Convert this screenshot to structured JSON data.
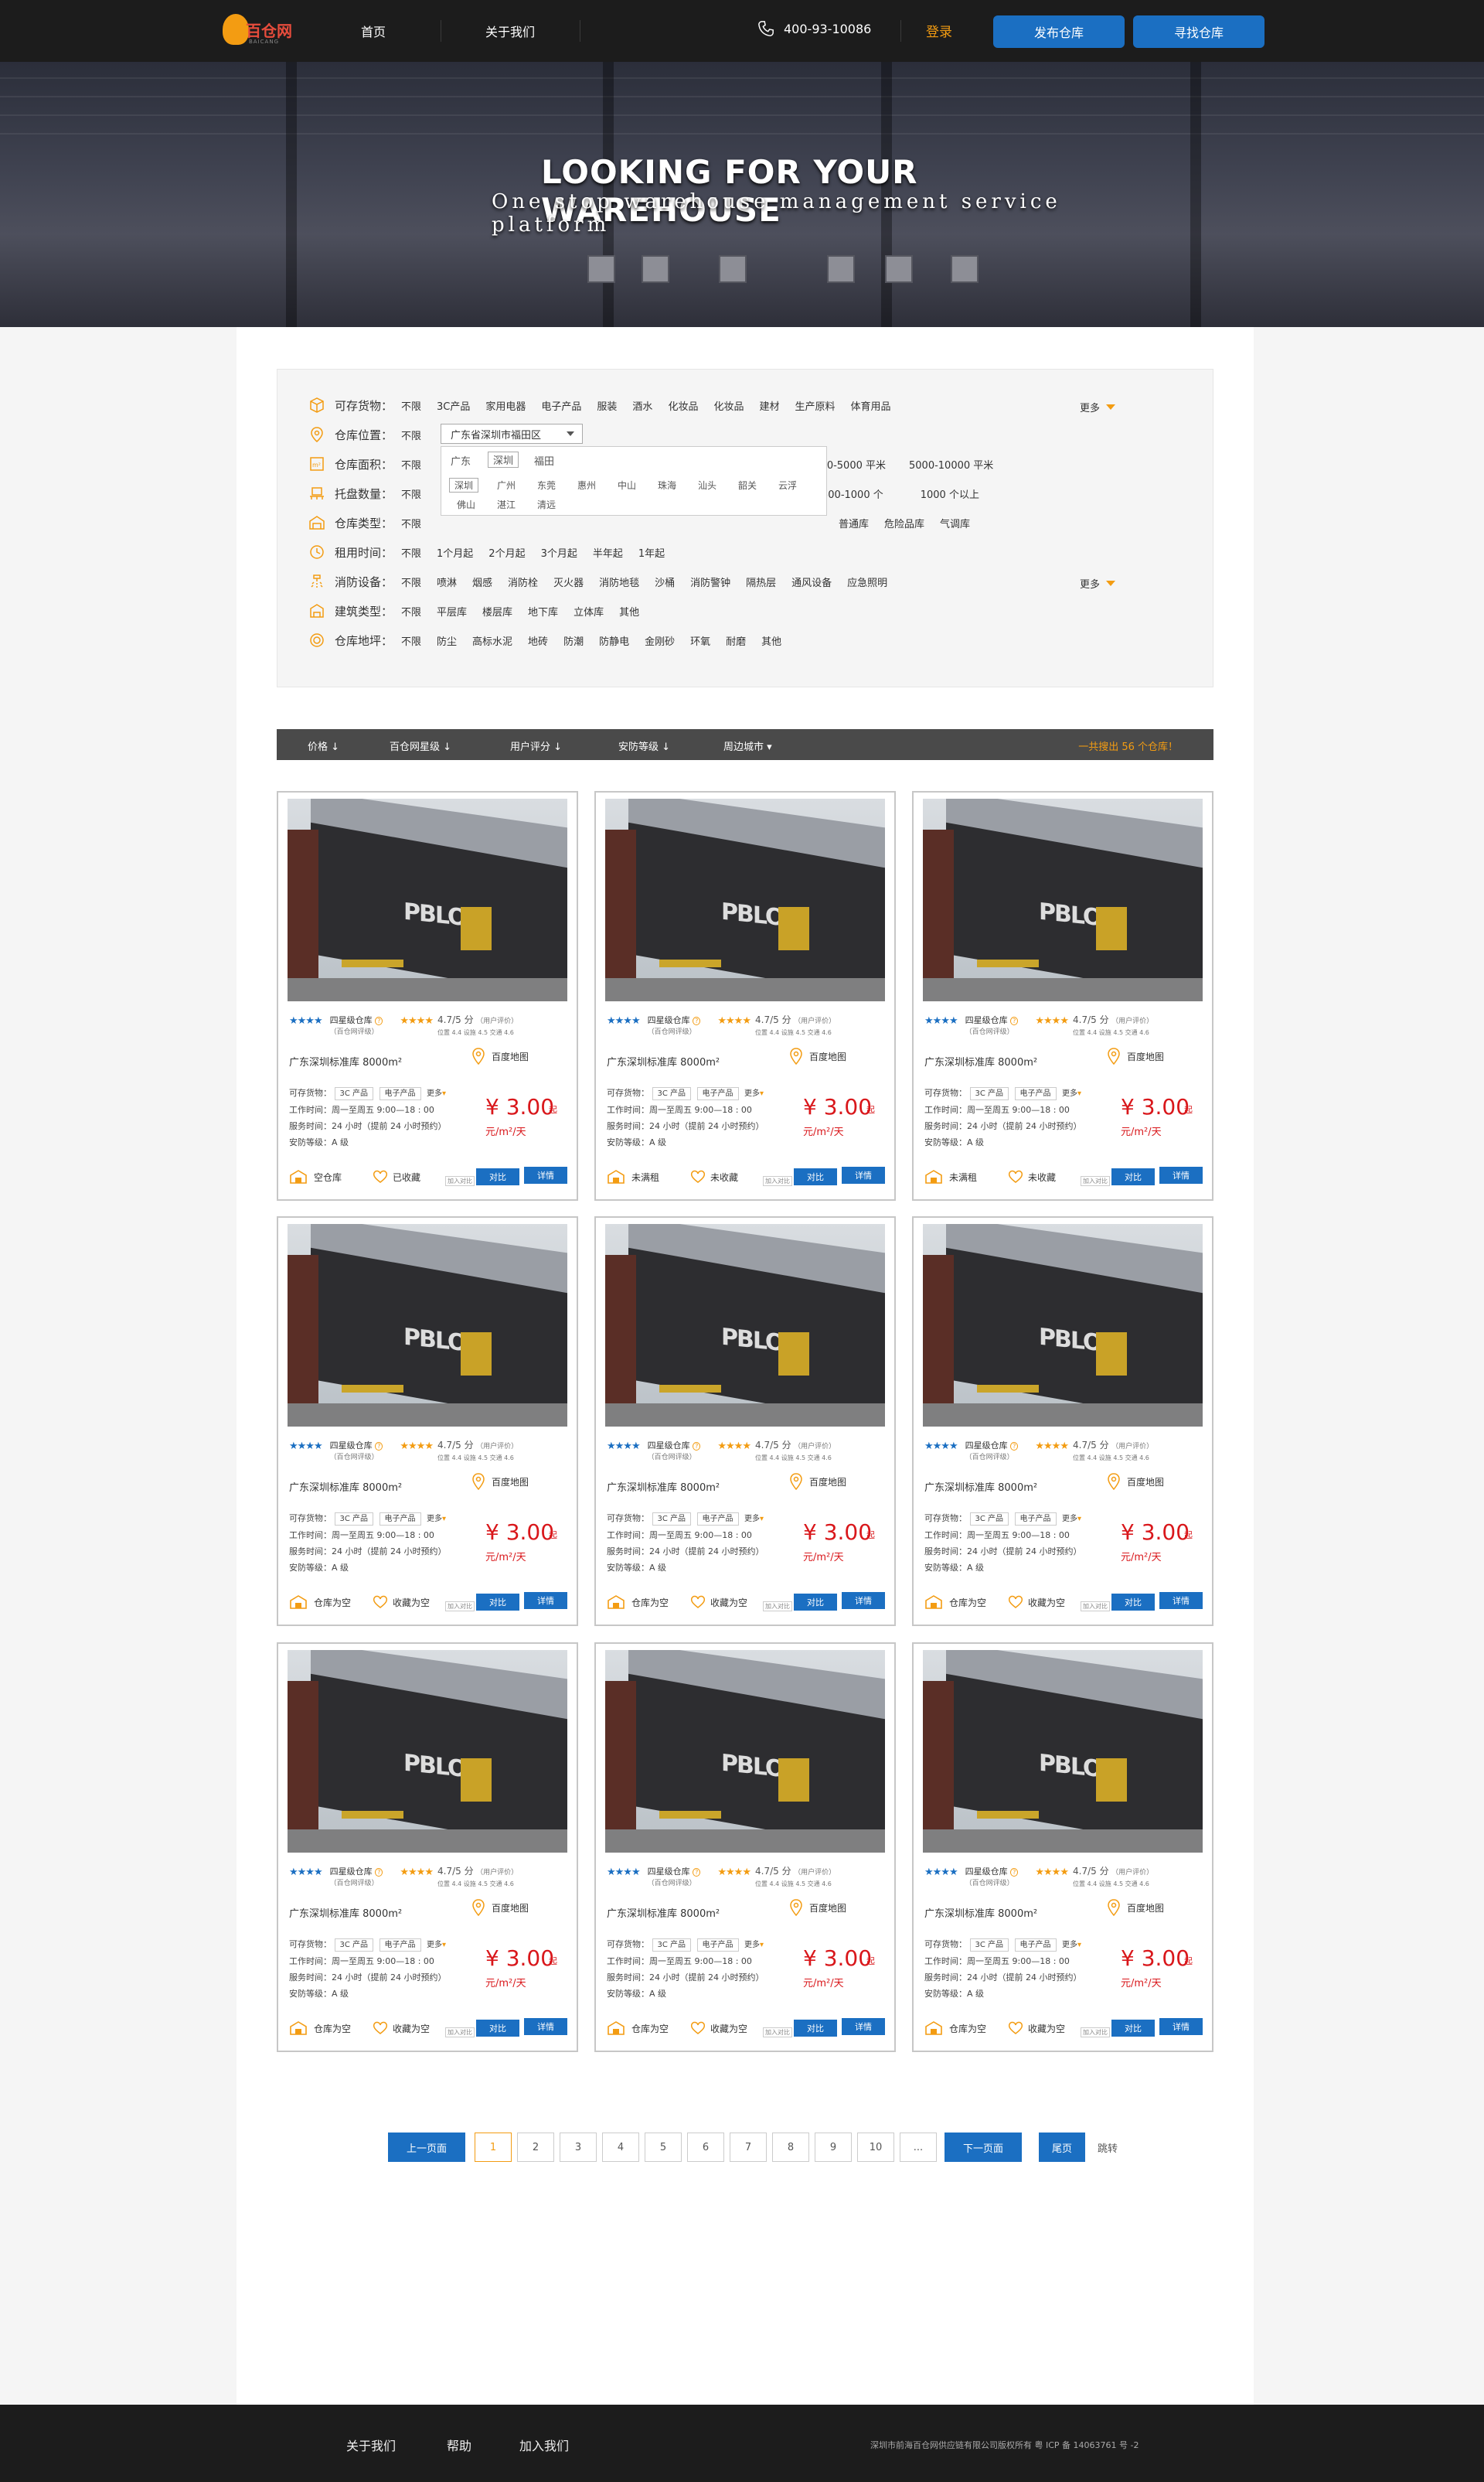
{
  "nav": {
    "logo_text": "百仓网",
    "logo_sub": "BAICANG",
    "home": "首页",
    "about": "关于我们",
    "phone": "400-93-10086",
    "login": "登录",
    "publish": "发布仓库",
    "find": "寻找仓库"
  },
  "hero": {
    "title": "LOOKING FOR YOUR WAREHOUSE",
    "subtitle": "One stop warehouse management service platform"
  },
  "filters": {
    "goods": {
      "label": "可存货物：",
      "opts": [
        "不限",
        "3C产品",
        "家用电器",
        "电子产品",
        "服装",
        "酒水",
        "化妆品",
        "化妆品",
        "建材",
        "生产原料",
        "体育用品"
      ],
      "more": "更多"
    },
    "location": {
      "label": "仓库位置：",
      "opts": [
        "不限"
      ],
      "select": "广东省深圳市福田区"
    },
    "area": {
      "label": "仓库面积：",
      "opts": [
        "不限"
      ],
      "tail": [
        "1000-5000 平米",
        "5000-10000 平米"
      ]
    },
    "pallet": {
      "label": "托盘数量：",
      "opts": [
        "不限"
      ],
      "tail": [
        "500-1000 个",
        "1000 个以上"
      ]
    },
    "type": {
      "label": "仓库类型：",
      "opts": [
        "不限"
      ],
      "tail": [
        "普通库",
        "危险品库",
        "气调库"
      ]
    },
    "rent": {
      "label": "租用时间：",
      "opts": [
        "不限",
        "1个月起",
        "2个月起",
        "3个月起",
        "半年起",
        "1年起"
      ]
    },
    "fire": {
      "label": "消防设备：",
      "opts": [
        "不限",
        "喷淋",
        "烟感",
        "消防栓",
        "灭火器",
        "消防地毯",
        "沙桶",
        "消防警钟",
        "隔热层",
        "通风设备",
        "应急照明"
      ],
      "more": "更多"
    },
    "build": {
      "label": "建筑类型：",
      "opts": [
        "不限",
        "平层库",
        "楼层库",
        "地下库",
        "立体库",
        "其他"
      ]
    },
    "floor": {
      "label": "仓库地坪：",
      "opts": [
        "不限",
        "防尘",
        "高标水泥",
        "地砖",
        "防潮",
        "防静电",
        "金刚砂",
        "环氧",
        "耐磨",
        "其他"
      ]
    },
    "loc_panel": {
      "tabs": [
        "广东",
        "深圳",
        "福田"
      ],
      "cities": [
        "深圳",
        "广州",
        "东莞",
        "惠州",
        "中山",
        "珠海",
        "汕头",
        "韶关",
        "云浮",
        "佛山",
        "湛江",
        "清远"
      ]
    }
  },
  "sort": {
    "items": [
      "价格",
      "百仓网星级",
      "用户评分",
      "安防等级",
      "周边城市"
    ],
    "total": "一共搜出 56 个仓库！"
  },
  "card_common": {
    "star_level": "四星级仓库",
    "star_sub": "（百仓网评级）",
    "rating": "4.7/5 分",
    "rating_sub": "（用户评价）",
    "sub_scores": "位置 4.4   设施 4.5   交通 4.6",
    "title": "广东深圳标准库 8000m²",
    "map": "百度地图",
    "goods_label": "可存货物：",
    "tags": [
      "3C 产品",
      "电子产品",
      "更多"
    ],
    "work_time": "工作时间：周一至周五   9:00—18 : 00",
    "service_time": "服务时间：24 小时（提前 24 小时预约）",
    "security": "安防等级：A 级",
    "price": "¥ 3.00",
    "price_qi": "起",
    "unit": "元/m²/天",
    "compare": "对比",
    "detail": "详情",
    "hint": "加入对比"
  },
  "cards": [
    {
      "status": "空仓库",
      "fav": "已收藏"
    },
    {
      "status": "未满租",
      "fav": "未收藏"
    },
    {
      "status": "未满租",
      "fav": "未收藏"
    },
    {
      "status": "仓库为空",
      "fav": "收藏为空"
    },
    {
      "status": "仓库为空",
      "fav": "收藏为空"
    },
    {
      "status": "仓库为空",
      "fav": "收藏为空"
    },
    {
      "status": "仓库为空",
      "fav": "收藏为空"
    },
    {
      "status": "仓库为空",
      "fav": "收藏为空"
    },
    {
      "status": "仓库为空",
      "fav": "收藏为空"
    }
  ],
  "pager": {
    "prev": "上一页面",
    "next": "下一页面",
    "last": "尾页",
    "jump": "跳转",
    "pages": [
      "1",
      "2",
      "3",
      "4",
      "5",
      "6",
      "7",
      "8",
      "9",
      "10",
      "..."
    ]
  },
  "footer": {
    "links": [
      "关于我们",
      "帮助",
      "加入我们"
    ],
    "copyright": "深圳市前海百仓网供应链有限公司版权所有   粤 ICP 备 14063761 号 -2"
  },
  "colors": {
    "accent": "#1b6fc2",
    "orange": "#f39c12",
    "price": "#d9171b"
  }
}
